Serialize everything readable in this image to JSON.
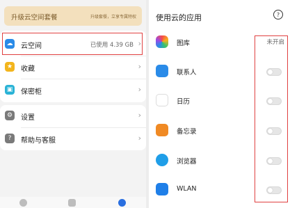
{
  "left": {
    "banner": {
      "title": "升级云空间套餐",
      "subtitle": "升级套餐，立享专属特权"
    },
    "menu1": [
      {
        "label": "云空间",
        "value": "已使用 4.39 GB",
        "icon": "cloud-icon"
      },
      {
        "label": "收藏",
        "icon": "star-icon"
      },
      {
        "label": "保密柜",
        "icon": "lock-icon"
      }
    ],
    "menu2": [
      {
        "label": "设置",
        "icon": "gear-icon"
      },
      {
        "label": "帮助与客服",
        "icon": "help-icon"
      }
    ],
    "bottom_nav": [
      "clock-icon",
      "folder-icon",
      "person-icon"
    ]
  },
  "right": {
    "title": "使用云的应用",
    "help_icon": "?",
    "apps": [
      {
        "label": "图库",
        "status": "未开启",
        "icon": "gallery-icon"
      },
      {
        "label": "联系人",
        "icon": "contacts-icon",
        "enabled": false
      },
      {
        "label": "日历",
        "icon": "calendar-icon",
        "enabled": false
      },
      {
        "label": "备忘录",
        "icon": "notes-icon",
        "enabled": false
      },
      {
        "label": "浏览器",
        "icon": "browser-icon",
        "enabled": false
      },
      {
        "label": "WLAN",
        "icon": "wlan-icon",
        "enabled": false
      }
    ]
  },
  "colors": {
    "highlight": "#e04040",
    "banner_bg": "#f3e0bd"
  }
}
